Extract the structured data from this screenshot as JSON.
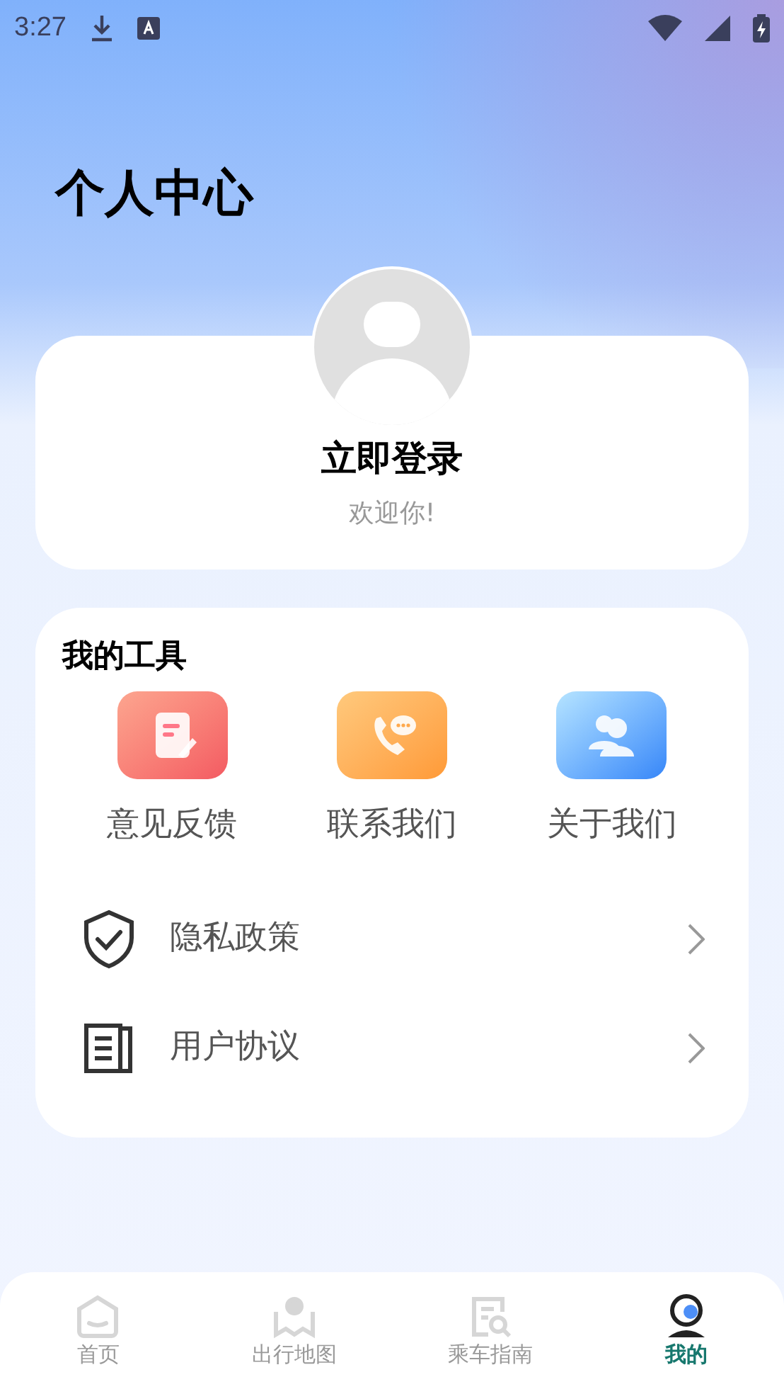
{
  "status_bar": {
    "time": "3:27"
  },
  "title": "个人中心",
  "profile": {
    "name": "立即登录",
    "greeting": "欢迎你!"
  },
  "tools": {
    "title": "我的工具",
    "items": [
      {
        "label": "意见反馈"
      },
      {
        "label": "联系我们"
      },
      {
        "label": "关于我们"
      }
    ],
    "rows": [
      {
        "label": "隐私政策"
      },
      {
        "label": "用户协议"
      }
    ]
  },
  "nav": [
    {
      "label": "首页",
      "selected": false
    },
    {
      "label": "出行地图",
      "selected": false
    },
    {
      "label": "乘车指南",
      "selected": false
    },
    {
      "label": "我的",
      "selected": true
    }
  ]
}
